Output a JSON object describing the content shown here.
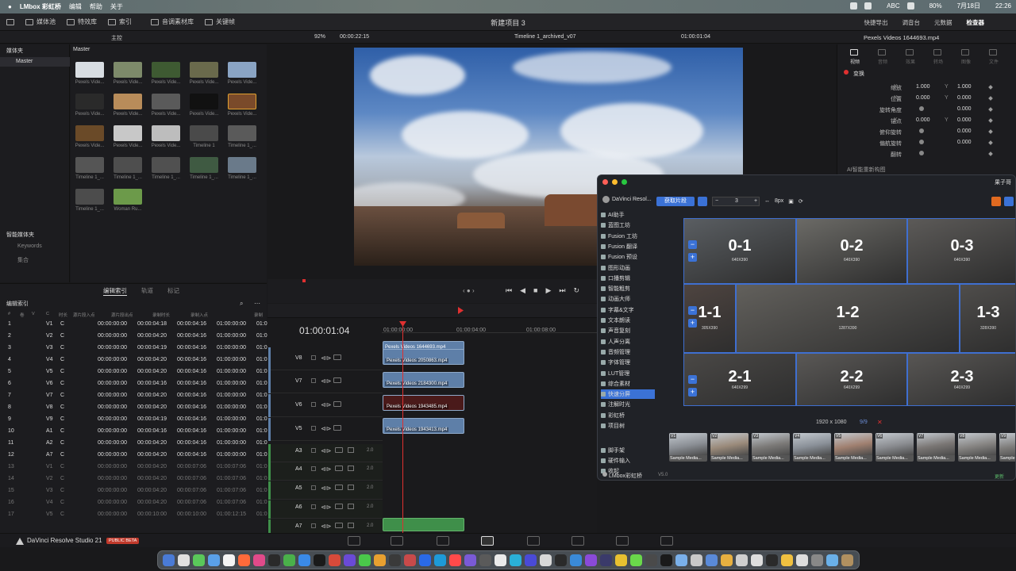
{
  "menubar": {
    "app": "LMbox 彩虹桥",
    "items": [
      "编辑",
      "帮助",
      "关于"
    ],
    "right": [
      "ABC",
      "80%",
      "7月18日",
      "22:26"
    ]
  },
  "toolbar": {
    "left": [
      "媒体池",
      "特效库",
      "索引",
      "音调素材库",
      "关键帧"
    ],
    "project_title": "新建项目 3",
    "right": [
      "快捷导出",
      "调音台",
      "元数据",
      "检查器"
    ]
  },
  "viewer_bar": {
    "bin_label": "主控",
    "zoom": "92%",
    "timecode": "00:00:22:15",
    "timeline_name": "Timeline 1_archived_v07",
    "record_tc": "01:00:01:04",
    "clip_name": "Pexels Videos 1644693.mp4"
  },
  "media_pool": {
    "sidebar_header": "媒体夹",
    "sidebar_master": "Master",
    "smart_bins": "智能媒体夹",
    "keywords": "Keywords",
    "collections": "集合",
    "master_title": "Master",
    "clips": [
      {
        "label": "Pexels Vide...",
        "color": "#d8dde2"
      },
      {
        "label": "Pexels Vide...",
        "color": "#7d8a6a"
      },
      {
        "label": "Pexels Vide...",
        "color": "#3e5a32"
      },
      {
        "label": "Pexels Vide...",
        "color": "#6a6a4c"
      },
      {
        "label": "Pexels Vide...",
        "color": "#8aa4c4"
      },
      {
        "label": "Pexels Vide...",
        "color": "#2a2a2a"
      },
      {
        "label": "Pexels Vide...",
        "color": "#b88c5a"
      },
      {
        "label": "Pexels Vide...",
        "color": "#5a5a5a"
      },
      {
        "label": "Pexels Vide...",
        "color": "#111111"
      },
      {
        "label": "Pexels Vide...",
        "color": "#7a4a2a"
      },
      {
        "label": "Pexels Vide...",
        "color": "#6a4a28"
      },
      {
        "label": "Pexels Vide...",
        "color": "#c8c8c8"
      },
      {
        "label": "Pexels Vide...",
        "color": "#bdbdbd"
      },
      {
        "label": "Timeline 1",
        "color": "#4a4a4a"
      },
      {
        "label": "Timeline 1_...",
        "color": "#5a5a5a"
      },
      {
        "label": "Timeline 1_...",
        "color": "#555555"
      },
      {
        "label": "Timeline 1_...",
        "color": "#4e4e4e"
      },
      {
        "label": "Timeline 1_...",
        "color": "#505050"
      },
      {
        "label": "Timeline 1_...",
        "color": "#3f5a42"
      },
      {
        "label": "Timeline 1_...",
        "color": "#6a7a8a"
      },
      {
        "label": "Timeline 1_...",
        "color": "#4c4c4c"
      },
      {
        "label": "Woman Ru...",
        "color": "#6c9a4a"
      }
    ]
  },
  "edit_index": {
    "tabs": [
      "编辑索引",
      "轨道",
      "标记"
    ],
    "title": "编辑索引",
    "columns": [
      "#",
      "卷",
      "V",
      "C",
      "时长",
      "源片段入点",
      "源片段出点",
      "录制时长",
      "录制入点",
      "录制"
    ],
    "rows": [
      [
        "1",
        "V1",
        "C",
        "00:00:00:00",
        "00:00:04:18",
        "00:00:04:16",
        "01:00:00:00",
        "01:0"
      ],
      [
        "2",
        "V2",
        "C",
        "00:00:00:00",
        "00:00:04:20",
        "00:00:04:16",
        "01:00:00:00",
        "01:0"
      ],
      [
        "3",
        "V3",
        "C",
        "00:00:00:00",
        "00:00:04:19",
        "00:00:04:16",
        "01:00:00:00",
        "01:0"
      ],
      [
        "4",
        "V4",
        "C",
        "00:00:00:00",
        "00:00:04:20",
        "00:00:04:16",
        "01:00:00:00",
        "01:0"
      ],
      [
        "5",
        "V5",
        "C",
        "00:00:00:00",
        "00:00:04:20",
        "00:00:04:16",
        "01:00:00:00",
        "01:0"
      ],
      [
        "6",
        "V6",
        "C",
        "00:00:00:00",
        "00:00:04:16",
        "00:00:04:16",
        "01:00:00:00",
        "01:0"
      ],
      [
        "7",
        "V7",
        "C",
        "00:00:00:00",
        "00:00:04:20",
        "00:00:04:16",
        "01:00:00:00",
        "01:0"
      ],
      [
        "8",
        "V8",
        "C",
        "00:00:00:00",
        "00:00:04:20",
        "00:00:04:16",
        "01:00:00:00",
        "01:0"
      ],
      [
        "9",
        "V9",
        "C",
        "00:00:00:00",
        "00:00:04:19",
        "00:00:04:16",
        "01:00:00:00",
        "01:0"
      ],
      [
        "10",
        "A1",
        "C",
        "00:00:00:00",
        "00:00:04:16",
        "00:00:04:16",
        "01:00:00:00",
        "01:0"
      ],
      [
        "11",
        "A2",
        "C",
        "00:00:00:00",
        "00:00:04:20",
        "00:00:04:16",
        "01:00:00:00",
        "01:0"
      ],
      [
        "12",
        "A7",
        "C",
        "00:00:00:00",
        "00:00:04:20",
        "00:00:04:16",
        "01:00:00:00",
        "01:0"
      ],
      [
        "13",
        "V1",
        "C",
        "00:00:00:00",
        "00:00:04:20",
        "00:00:07:06",
        "01:00:07:06",
        "01:0"
      ],
      [
        "14",
        "V2",
        "C",
        "00:00:00:00",
        "00:00:04:20",
        "00:00:07:06",
        "01:00:07:06",
        "01:0"
      ],
      [
        "15",
        "V3",
        "C",
        "00:00:00:00",
        "00:00:04:20",
        "00:00:07:06",
        "01:00:07:06",
        "01:0"
      ],
      [
        "16",
        "V4",
        "C",
        "00:00:00:00",
        "00:00:04:20",
        "00:00:07:06",
        "01:00:07:06",
        "01:0"
      ],
      [
        "17",
        "V5",
        "C",
        "00:00:00:00",
        "00:00:10:00",
        "00:00:10:00",
        "01:00:12:15",
        "01:0"
      ]
    ]
  },
  "timeline": {
    "timecode": "01:00:01:04",
    "ruler": [
      "01:00:00:00",
      "01:00:04:00",
      "01:00:08:00"
    ],
    "tracks": [
      "V8",
      "V7",
      "V6",
      "V5",
      "A3",
      "A4",
      "A5",
      "A6",
      "A7"
    ],
    "clips": [
      "Pexels Videos 1644693.mp4",
      "Pexels Videos 2050863.mp4",
      "Pexels Videos 2184300.mp4",
      "Pexels Videos 1943485.mp4",
      "Pexels Videos 1943413.mp4"
    ],
    "audio_level": "2.0"
  },
  "inspector": {
    "tabs": [
      "视频",
      "音频",
      "效果",
      "转场",
      "图像",
      "文件"
    ],
    "section": "变换",
    "rows": [
      {
        "label": "缩放",
        "x": "1.000",
        "y": "1.000"
      },
      {
        "label": "位置",
        "x": "0.000",
        "y": "0.000"
      },
      {
        "label": "旋转角度",
        "x": "",
        "y": "0.000"
      },
      {
        "label": "锚点",
        "x": "0.000",
        "y": "0.000"
      },
      {
        "label": "俯仰旋转",
        "x": "",
        "y": "0.000"
      },
      {
        "label": "偏航旋转",
        "x": "",
        "y": "0.000"
      },
      {
        "label": "翻转",
        "x": "",
        "y": ""
      }
    ],
    "ai_section": "AI智能重新构图"
  },
  "plugin": {
    "title": "DaVinci Resol...",
    "brand_right": "果子哥",
    "get_clips": "获取片段",
    "count": "3",
    "px": "8px",
    "menu": [
      "AI助手",
      "蓝图工坊",
      "Fusion 工坊",
      "Fusion 翻译",
      "Fusion 预设",
      "图形动画",
      "口播剪辑",
      "智能粗剪",
      "动画大师",
      "字幕&文字",
      "文本朗读",
      "声音复刻",
      "人声分离",
      "音频管理",
      "字体管理",
      "LUT管理",
      "综合素材",
      "快速分屏",
      "注解时光",
      "彩虹桥",
      "项目树",
      "脚手架",
      "硬件输入",
      "收起"
    ],
    "active_index": 17,
    "grid": [
      {
        "label": "0-1",
        "size": "640X390"
      },
      {
        "label": "0-2",
        "size": "640X390"
      },
      {
        "label": "0-3",
        "size": "640X390"
      },
      {
        "label": "1-1",
        "size": "305X390"
      },
      {
        "label": "1-2",
        "size": "1287X390"
      },
      {
        "label": "1-3",
        "size": "328X390"
      },
      {
        "label": "2-1",
        "size": "640X299"
      },
      {
        "label": "2-2",
        "size": "640X299"
      },
      {
        "label": "2-3",
        "size": "640X299"
      }
    ],
    "resolution": "1920 x 1080",
    "ratio": "9/9",
    "strip": [
      {
        "v": "V1",
        "name": "Sample Media..."
      },
      {
        "v": "V2",
        "name": "Sample Media..."
      },
      {
        "v": "V3",
        "name": "Sample Media..."
      },
      {
        "v": "V4",
        "name": "Sample Media..."
      },
      {
        "v": "V5",
        "name": "Sample Media..."
      },
      {
        "v": "V6",
        "name": "Sample Media..."
      },
      {
        "v": "V7",
        "name": "Sample Media..."
      },
      {
        "v": "V8",
        "name": "Sample Media..."
      },
      {
        "v": "V9",
        "name": "Sample..."
      }
    ],
    "footer": "LMbox彩虹桥",
    "version": "V5.0",
    "footer_right": "更新"
  },
  "statusbar": {
    "app_name": "DaVinci Resolve Studio 21",
    "badge": "PUBLIC BETA"
  },
  "colors": {
    "accent": "#3b72d6",
    "playhead": "#e03030",
    "video_clip": "#5e7fa8",
    "audio_clip": "#3f8f4a"
  }
}
